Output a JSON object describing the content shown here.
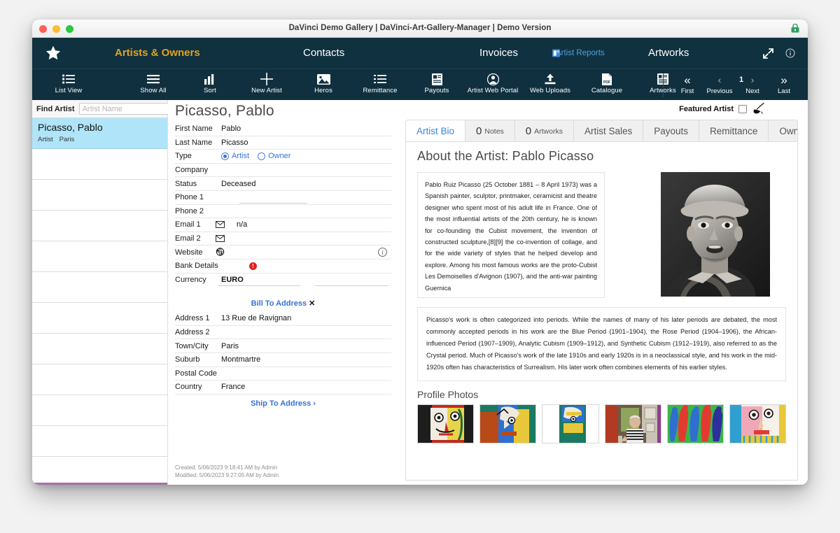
{
  "window": {
    "title": "DaVinci Demo Gallery | DaVinci-Art-Gallery-Manager | Demo Version",
    "lock_icon": "lock-icon",
    "traffic_lights": [
      "close-red",
      "minimize-yellow",
      "zoom-green"
    ]
  },
  "nav": {
    "star_icon": "star-icon",
    "items": [
      {
        "label": "Artists & Owners",
        "active": true
      },
      {
        "label": "Contacts",
        "active": false
      },
      {
        "label": "Invoices",
        "active": false
      },
      {
        "label": "Artist Reports",
        "active": false,
        "icon": "report-icon"
      },
      {
        "label": "Artworks",
        "active": false
      }
    ],
    "expand_icon": "expand-arrows-icon",
    "info_icon": "info-icon"
  },
  "toolbar": {
    "buttons": [
      {
        "label": "List View",
        "icon": "list-view-icon"
      },
      {
        "label": "Show All",
        "icon": "show-all-icon"
      },
      {
        "label": "Sort",
        "icon": "sort-bars-icon"
      },
      {
        "label": "New Artist",
        "icon": "plus-icon"
      },
      {
        "label": "Heros",
        "icon": "image-icon"
      },
      {
        "label": "Remittance",
        "icon": "list-icon"
      },
      {
        "label": "Payouts",
        "icon": "document-icon"
      },
      {
        "label": "Artist Web Portal",
        "icon": "person-circle-icon"
      },
      {
        "label": "Web Uploads",
        "icon": "upload-icon"
      },
      {
        "label": "Catalogue",
        "icon": "pdf-icon"
      },
      {
        "label": "Artworks",
        "icon": "artwork-list-icon"
      }
    ],
    "pagination": [
      {
        "label": "First",
        "glyph": "«",
        "icon": "first-page-icon"
      },
      {
        "label": "Previous",
        "glyph": "‹",
        "icon": "previous-page-icon"
      },
      {
        "label": "Next",
        "glyph": "›",
        "icon": "next-page-icon"
      },
      {
        "label": "Last",
        "glyph": "»",
        "icon": "last-page-icon"
      }
    ],
    "page_number": "1"
  },
  "sidebar": {
    "find_label": "Find Artist",
    "find_placeholder": "Artist Name",
    "find_value": "",
    "rows": [
      {
        "title": "Picasso, Pablo",
        "type": "Artist",
        "city": "Paris",
        "selected": true
      },
      {
        "title": "",
        "type": "",
        "city": "",
        "selected": false
      },
      {
        "title": "",
        "type": "",
        "city": "",
        "selected": false
      },
      {
        "title": "",
        "type": "",
        "city": "",
        "selected": false
      },
      {
        "title": "",
        "type": "",
        "city": "",
        "selected": false
      },
      {
        "title": "",
        "type": "",
        "city": "",
        "selected": false
      },
      {
        "title": "",
        "type": "",
        "city": "",
        "selected": false
      },
      {
        "title": "",
        "type": "",
        "city": "",
        "selected": false
      },
      {
        "title": "",
        "type": "",
        "city": "",
        "selected": false
      },
      {
        "title": "",
        "type": "",
        "city": "",
        "selected": false
      },
      {
        "title": "",
        "type": "",
        "city": "",
        "selected": false
      },
      {
        "title": "",
        "type": "",
        "city": "",
        "selected": false
      }
    ]
  },
  "detail": {
    "record_title": "Picasso, Pablo",
    "fields": {
      "first_name_label": "First Name",
      "first_name_value": "Pablo",
      "last_name_label": "Last Name",
      "last_name_value": "Picasso",
      "type_label": "Type",
      "type_options": [
        {
          "label": "Artist",
          "selected": true
        },
        {
          "label": "Owner",
          "selected": false
        }
      ],
      "company_label": "Company",
      "company_value": "",
      "status_label": "Status",
      "status_value": "Deceased",
      "phone1_label": "Phone 1",
      "phone1_value": "",
      "phone2_label": "Phone 2",
      "phone2_value": "",
      "email1_label": "Email 1",
      "email1_value": "n/a",
      "email2_label": "Email 2",
      "email2_value": "",
      "website_label": "Website",
      "website_value": "",
      "bank_details_label": "Bank Details",
      "bank_details_alert": "!",
      "currency_label": "Currency",
      "currency_value": "EURO"
    },
    "bill_to_header": "Bill To Address",
    "bill_to_close": "✕",
    "address": {
      "address1_label": "Address 1",
      "address1_value": "13 Rue de Ravignan",
      "address2_label": "Address 2",
      "address2_value": "",
      "town_label": "Town/City",
      "town_value": "Paris",
      "suburb_label": "Suburb",
      "suburb_value": "Montmartre",
      "postal_label": "Postal Code",
      "postal_value": "",
      "country_label": "Country",
      "country_value": "France"
    },
    "ship_to_header": "Ship To Address",
    "ship_to_chevron": "›",
    "created": "Created: 5/06/2023 9:18:41 AM by Admin",
    "modified": "Modified: 5/06/2023 9:27:05 AM by Admin"
  },
  "right": {
    "featured_label": "Featured Artist",
    "featured_checked": false,
    "brush_icon": "brush-icon",
    "tabs": [
      {
        "label": "Artist Bio",
        "count": "",
        "active": true
      },
      {
        "label": "Notes",
        "count": "0",
        "active": false
      },
      {
        "label": "Artworks",
        "count": "0",
        "active": false
      },
      {
        "label": "Artist Sales",
        "count": "",
        "active": false
      },
      {
        "label": "Payouts",
        "count": "",
        "active": false
      },
      {
        "label": "Remittance",
        "count": "",
        "active": false
      },
      {
        "label": "Owned",
        "count": "",
        "active": false
      }
    ],
    "about_heading": "About the Artist: Pablo Picasso",
    "bio_text": "Pablo Ruiz Picasso (25 October 1881 – 8 April 1973) was a Spanish painter, sculptor, printmaker, ceramicist and theatre designer who spent most of his adult life in France. One of the most influential artists of the 20th century, he is known for co-founding the Cubist movement, the invention of constructed sculpture,[8][9] the co-invention of collage, and for the wide variety of styles that he helped develop and explore. Among his most famous works are the proto-Cubist Les Demoiselles d'Avignon (1907), and the anti-war painting Guernica",
    "portrait_alt": "artist-portrait-photo",
    "periods_text": "Picasso's work is often categorized into periods. While the names of many of his later periods are debated, the most commonly accepted periods in his work are the Blue Period (1901–1904), the Rose Period (1904–1906), the African-influenced Period (1907–1909), Analytic Cubism (1909–1912), and Synthetic Cubism (1912–1919), also referred to as the Crystal period. Much of Picasso's work of the late 1910s and early 1920s is in a neoclassical style, and his work in the mid-1920s often has characteristics of Surrealism. His later work often combines elements of his earlier styles.",
    "photos_heading": "Profile Photos",
    "photos": [
      {
        "name": "profile-photo-1"
      },
      {
        "name": "profile-photo-2"
      },
      {
        "name": "profile-photo-3"
      },
      {
        "name": "profile-photo-4"
      },
      {
        "name": "profile-photo-5"
      },
      {
        "name": "profile-photo-6"
      }
    ]
  },
  "colors": {
    "nav_navy": "#103140",
    "accent_gold": "#e3a31a",
    "link_blue": "#3572d6",
    "selection_blue": "#b0e4f8",
    "alert_red": "#e02020",
    "rule_purple": "#a56fa8"
  }
}
